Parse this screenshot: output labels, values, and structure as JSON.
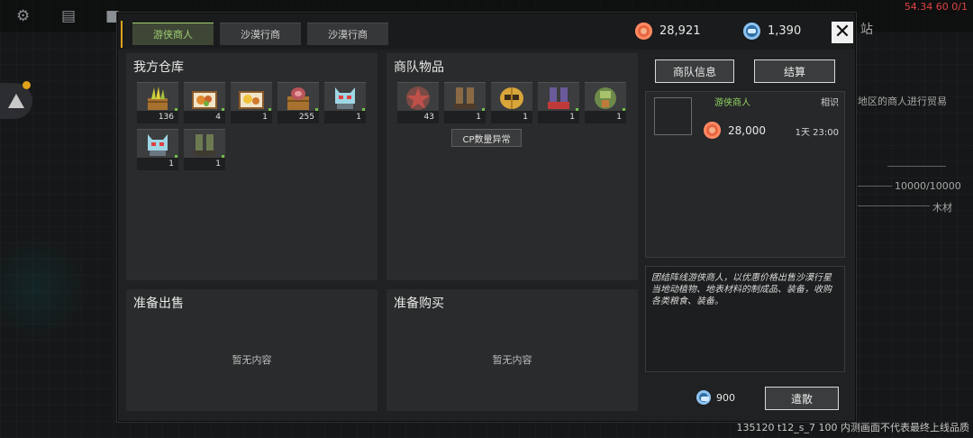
{
  "background": {
    "hud_gold": "28,921",
    "hud_chips": "1,390",
    "corner_red": "54.34 60 0/1",
    "side_text_1": "站",
    "side_text_2": "地区的商人进行贸易",
    "side_text_3": "10000/10000",
    "side_text_4": "木材",
    "build_info": "135120 t12_s_7 100 内测画面不代表最终上线品质"
  },
  "tabs": [
    {
      "label": "游侠商人",
      "active": true
    },
    {
      "label": "沙漠行商",
      "active": false
    },
    {
      "label": "沙漠行商",
      "active": false
    }
  ],
  "currency": {
    "gold": "28,921",
    "chips": "1,390"
  },
  "close_label": "✕",
  "warehouse": {
    "title": "我方仓库",
    "items": [
      {
        "icon": "crop-crate-icon",
        "count": "136"
      },
      {
        "icon": "food-tray-icon",
        "count": "4"
      },
      {
        "icon": "meal-tray-icon",
        "count": "1"
      },
      {
        "icon": "meat-crate-icon",
        "count": "255"
      },
      {
        "icon": "mech-head-icon",
        "count": "1"
      },
      {
        "icon": "mech-head-icon",
        "count": "1"
      },
      {
        "icon": "boots-icon",
        "count": "1"
      }
    ]
  },
  "caravan": {
    "title": "商队物品",
    "items": [
      {
        "icon": "star-badge-icon",
        "count": "43"
      },
      {
        "icon": "boots-icon",
        "count": "1"
      },
      {
        "icon": "helmet-icon",
        "count": "1"
      },
      {
        "icon": "red-boots-icon",
        "count": "1"
      },
      {
        "icon": "armor-icon",
        "count": "1"
      }
    ],
    "cp_button": "CP数量异常"
  },
  "sell": {
    "title": "准备出售",
    "empty": "暂无内容"
  },
  "buy": {
    "title": "准备购买",
    "empty": "暂无内容"
  },
  "right": {
    "info_button": "商队信息",
    "settle_button": "结算",
    "merchant_name": "游侠商人",
    "relation": "相识",
    "price": "28,000",
    "time": "1天 23:00",
    "description": "团结阵线游侠商人，以优惠价格出售沙漠行星当地动植物、地表材料的制成品、装备，收购各类粮食、装备。",
    "dismiss_cost": "900",
    "dismiss_button": "遣散"
  }
}
